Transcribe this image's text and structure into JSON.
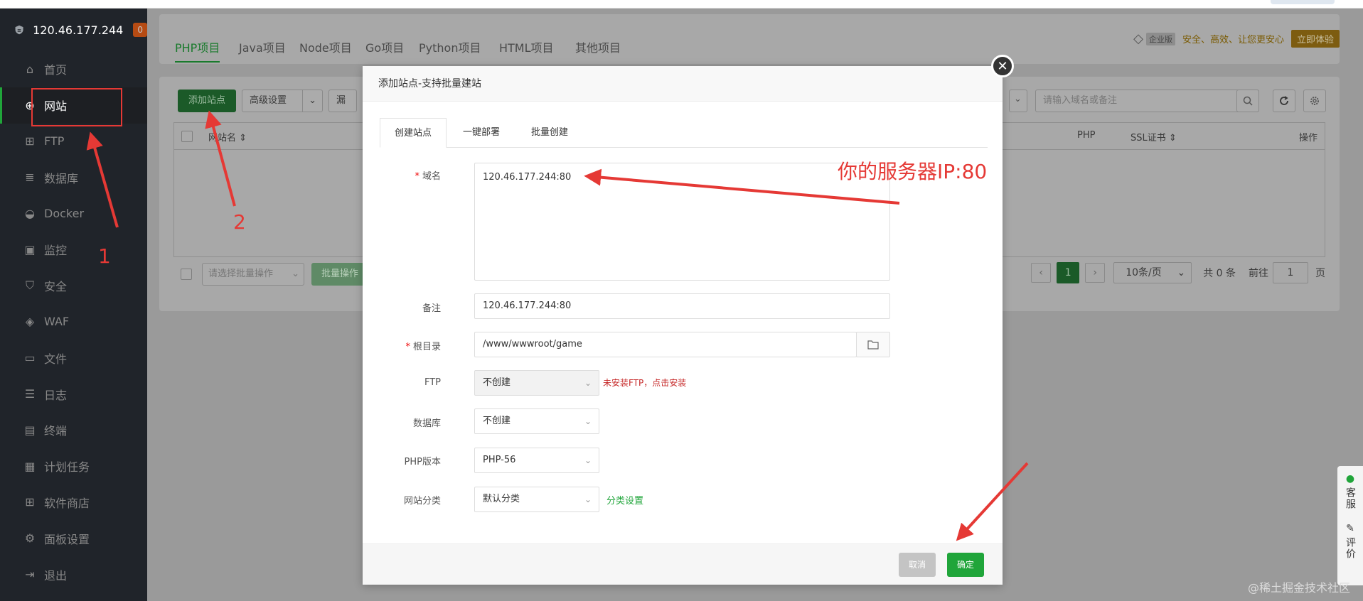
{
  "server": {
    "ip": "120.46.177.244",
    "badge": "0"
  },
  "sidebar": {
    "items": [
      {
        "label": "首页",
        "icon": "home-icon"
      },
      {
        "label": "网站",
        "icon": "globe-icon"
      },
      {
        "label": "FTP",
        "icon": "ftp-icon"
      },
      {
        "label": "数据库",
        "icon": "database-icon"
      },
      {
        "label": "Docker",
        "icon": "docker-icon"
      },
      {
        "label": "监控",
        "icon": "monitor-icon"
      },
      {
        "label": "安全",
        "icon": "shield-icon"
      },
      {
        "label": "WAF",
        "icon": "waf-icon"
      },
      {
        "label": "文件",
        "icon": "folder-icon"
      },
      {
        "label": "日志",
        "icon": "log-icon"
      },
      {
        "label": "终端",
        "icon": "terminal-icon"
      },
      {
        "label": "计划任务",
        "icon": "calendar-icon"
      },
      {
        "label": "软件商店",
        "icon": "store-icon"
      },
      {
        "label": "面板设置",
        "icon": "gear-icon"
      },
      {
        "label": "退出",
        "icon": "logout-icon"
      }
    ]
  },
  "project_tabs": [
    "PHP项目",
    "Java项目",
    "Node项目",
    "Go项目",
    "Python项目",
    "HTML项目",
    "其他项目"
  ],
  "enterprise": {
    "tag": "企业版",
    "slogan": "安全、高效、让您更安心",
    "button": "立即体验"
  },
  "toolbar": {
    "add_site": "添加站点",
    "advanced": "高级设置",
    "vuln": "漏",
    "search_placeholder": "请输入域名或备注"
  },
  "table": {
    "col_name": "网站名",
    "col_php": "PHP",
    "col_ssl": "SSL证书",
    "col_ops": "操作"
  },
  "batch": {
    "select_placeholder": "请选择批量操作",
    "button": "批量操作"
  },
  "pagination": {
    "current": "1",
    "per_page": "10条/页",
    "total": "共 0 条",
    "goto_label": "前往",
    "goto_value": "1",
    "page_unit": "页"
  },
  "modal": {
    "title": "添加站点-支持批量建站",
    "tabs": [
      "创建站点",
      "一键部署",
      "批量创建"
    ],
    "domain_label": "域名",
    "domain_value": "120.46.177.244:80",
    "remark_label": "备注",
    "remark_value": "120.46.177.244:80",
    "root_label": "根目录",
    "root_value": "/www/wwwroot/game",
    "ftp_label": "FTP",
    "ftp_value": "不创建",
    "ftp_note": "未安装FTP，点击安装",
    "db_label": "数据库",
    "db_value": "不创建",
    "php_label": "PHP版本",
    "php_value": "PHP-56",
    "category_label": "网站分类",
    "category_value": "默认分类",
    "category_link": "分类设置",
    "cancel": "取消",
    "confirm": "确定"
  },
  "annotations": {
    "ip_note": "你的服务器IP:80",
    "step1": "1",
    "step2": "2"
  },
  "side_tools": {
    "service": "客服",
    "review": "评价"
  },
  "watermark": "@稀土掘金技术社区",
  "colors": {
    "accent": "#20a53a",
    "annotation": "#e53935",
    "sidebar_bg": "#20242a"
  }
}
